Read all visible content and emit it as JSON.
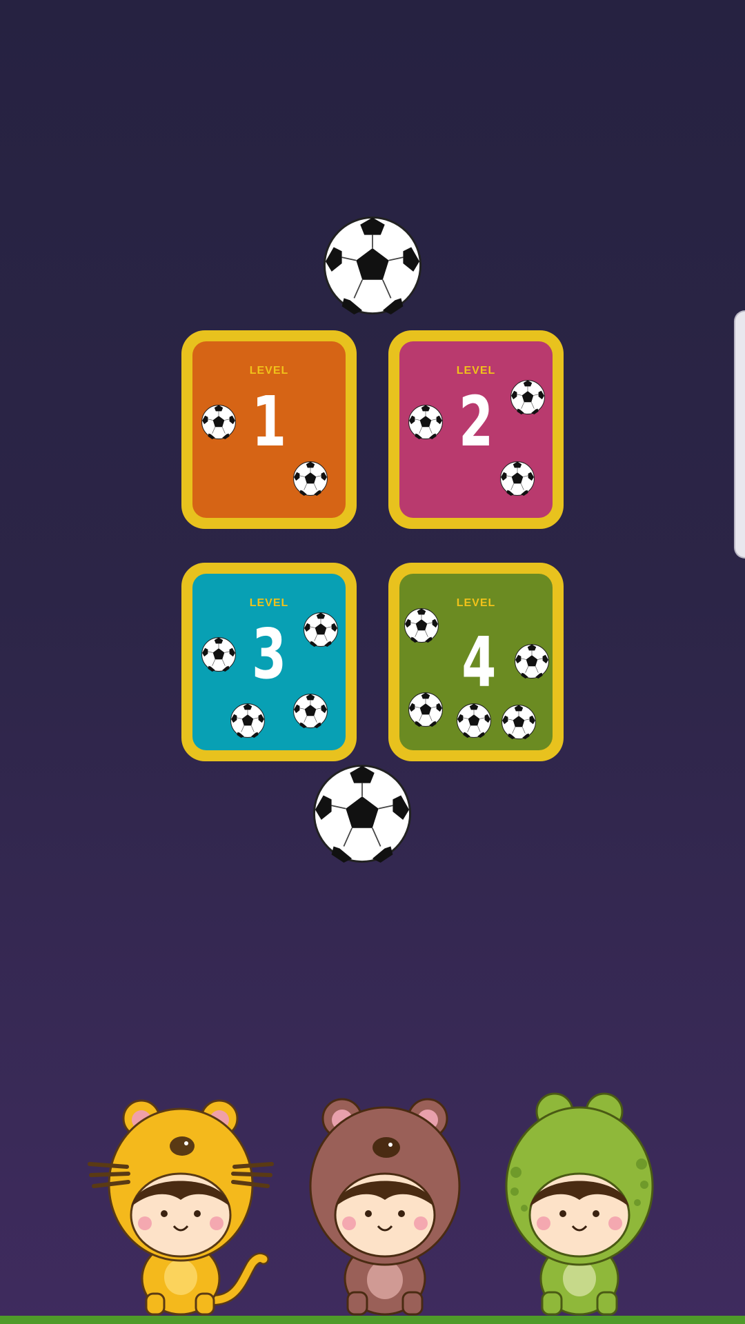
{
  "screen": {
    "background": "#262241"
  },
  "level_cards": [
    {
      "label": "LEVEL",
      "number": "1",
      "color": "#d66415"
    },
    {
      "label": "LEVEL",
      "number": "2",
      "color": "#b93a6e"
    },
    {
      "label": "LEVEL",
      "number": "3",
      "color": "#08a0b4"
    },
    {
      "label": "LEVEL",
      "number": "4",
      "color": "#6b8b22"
    }
  ],
  "characters": [
    "tiger-costume-kid",
    "bear-costume-kid",
    "frog-costume-kid"
  ],
  "colors": {
    "card_border": "#e8c21e",
    "level_text": "#f1c21a",
    "ground": "#4f9b2a"
  }
}
